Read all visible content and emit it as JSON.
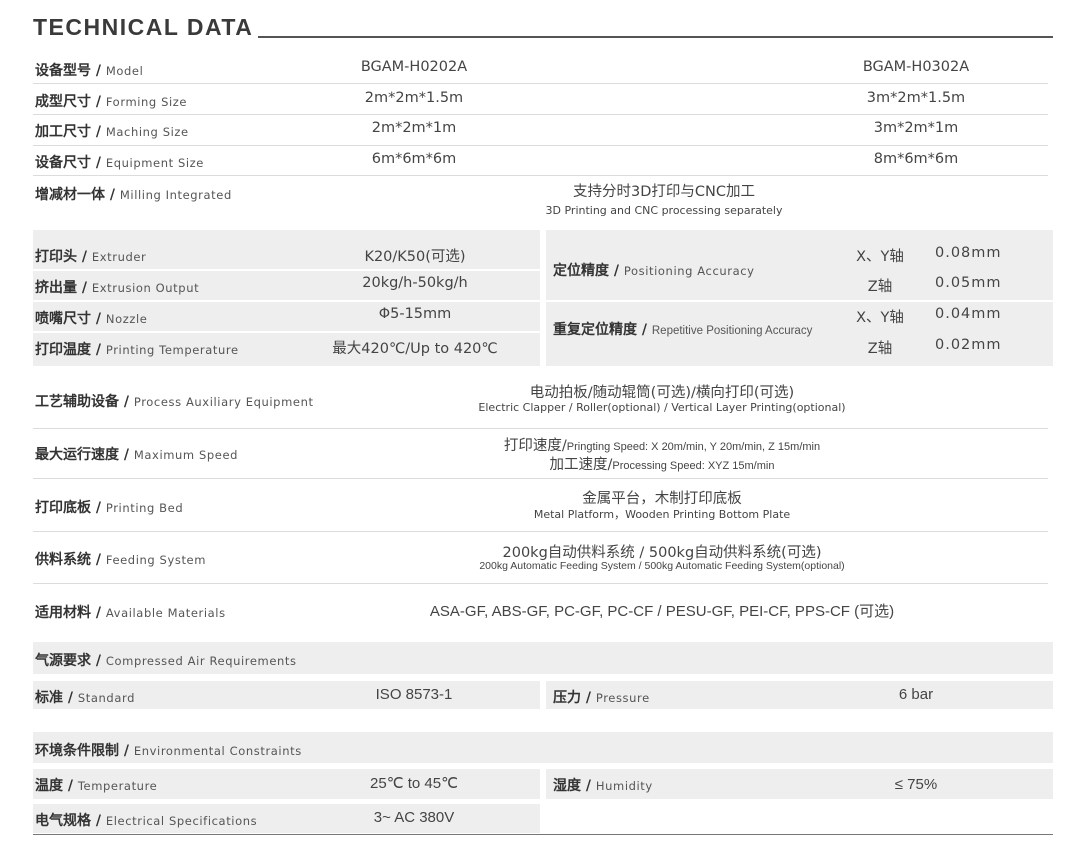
{
  "title": "TECHNICAL DATA",
  "models": [
    "BGAM-H0202A",
    "BGAM-H0302A"
  ],
  "basic_rows": [
    {
      "cn": "设备型号",
      "en": "Model",
      "v1": "BGAM-H0202A",
      "v2": "BGAM-H0302A"
    },
    {
      "cn": "成型尺寸",
      "en": "Forming Size",
      "v1": "2m*2m*1.5m",
      "v2": "3m*2m*1.5m"
    },
    {
      "cn": "加工尺寸",
      "en": "Maching Size",
      "v1": "2m*2m*1m",
      "v2": "3m*2m*1m"
    },
    {
      "cn": "设备尺寸",
      "en": "Equipment Size",
      "v1": "6m*6m*6m",
      "v2": "8m*6m*6m"
    }
  ],
  "milling": {
    "cn": "增减材一体",
    "en": "Milling Integrated",
    "v_cn": "支持分时3D打印与CNC加工",
    "v_en": "3D Printing and CNC processing separately"
  },
  "print_rows": [
    {
      "cn": "打印头",
      "en": "Extruder",
      "v": "K20/K50(可选)"
    },
    {
      "cn": "挤出量",
      "en": "Extrusion Output",
      "v": "20kg/h-50kg/h"
    },
    {
      "cn": "喷嘴尺寸",
      "en": "Nozzle",
      "v": "Φ5-15mm"
    },
    {
      "cn": "打印温度",
      "en": "Printing Temperature",
      "v": "最大420℃/Up to 420℃"
    }
  ],
  "positioning": {
    "cn": "定位精度",
    "en": "Positioning Accuracy",
    "xy_label": "X、Y轴",
    "xy_val": "0.08mm",
    "z_label": "Z轴",
    "z_val": "0.05mm"
  },
  "repetitive": {
    "cn": "重复定位精度",
    "en": "Repetitive Positioning Accuracy",
    "xy_label": "X、Y轴",
    "xy_val": "0.04mm",
    "z_label": "Z轴",
    "z_val": "0.02mm"
  },
  "aux": {
    "cn": "工艺辅助设备",
    "en": "Process Auxiliary Equipment",
    "v_cn": "电动拍板/随动辊筒(可选)/横向打印(可选)",
    "v_en": "Electric Clapper / Roller(optional) / Vertical Layer Printing(optional)"
  },
  "speed": {
    "cn": "最大运行速度",
    "en": "Maximum Speed",
    "l1_cn": "打印速度/",
    "l1_en": "Pringting Speed: X 20m/min, Y 20m/min, Z 15m/min",
    "l2_cn": "加工速度/",
    "l2_en": "Processing Speed:  XYZ 15m/min"
  },
  "bed": {
    "cn": "打印底板",
    "en": "Printing Bed",
    "v_cn": "金属平台，木制打印底板",
    "v_en": "Metal Platform，Wooden Printing Bottom Plate"
  },
  "feeding": {
    "cn": "供料系统",
    "en": "Feeding System",
    "v_cn": "200kg自动供料系统 / 500kg自动供料系统(可选)",
    "v_en": "200kg Automatic Feeding System / 500kg Automatic Feeding System(optional)"
  },
  "materials": {
    "cn": "适用材料",
    "en": "Available Materials",
    "v": "ASA-GF, ABS-GF, PC-GF, PC-CF / PESU-GF, PEI-CF, PPS-CF (可选)"
  },
  "air": {
    "cn": "气源要求",
    "en": "Compressed Air Requirements",
    "std_cn": "标准",
    "std_en": "Standard",
    "std_v": "ISO 8573-1",
    "p_cn": "压力",
    "p_en": "Pressure",
    "p_v": "6 bar"
  },
  "env": {
    "cn": "环境条件限制",
    "en": "Environmental Constraints",
    "t_cn": "温度",
    "t_en": "Temperature",
    "t_v": "25℃ to 45℃",
    "h_cn": "湿度",
    "h_en": "Humidity",
    "h_v": "≤ 75%",
    "e_cn": "电气规格",
    "e_en": "Electrical Specifications",
    "e_v": "3~ AC 380V"
  }
}
